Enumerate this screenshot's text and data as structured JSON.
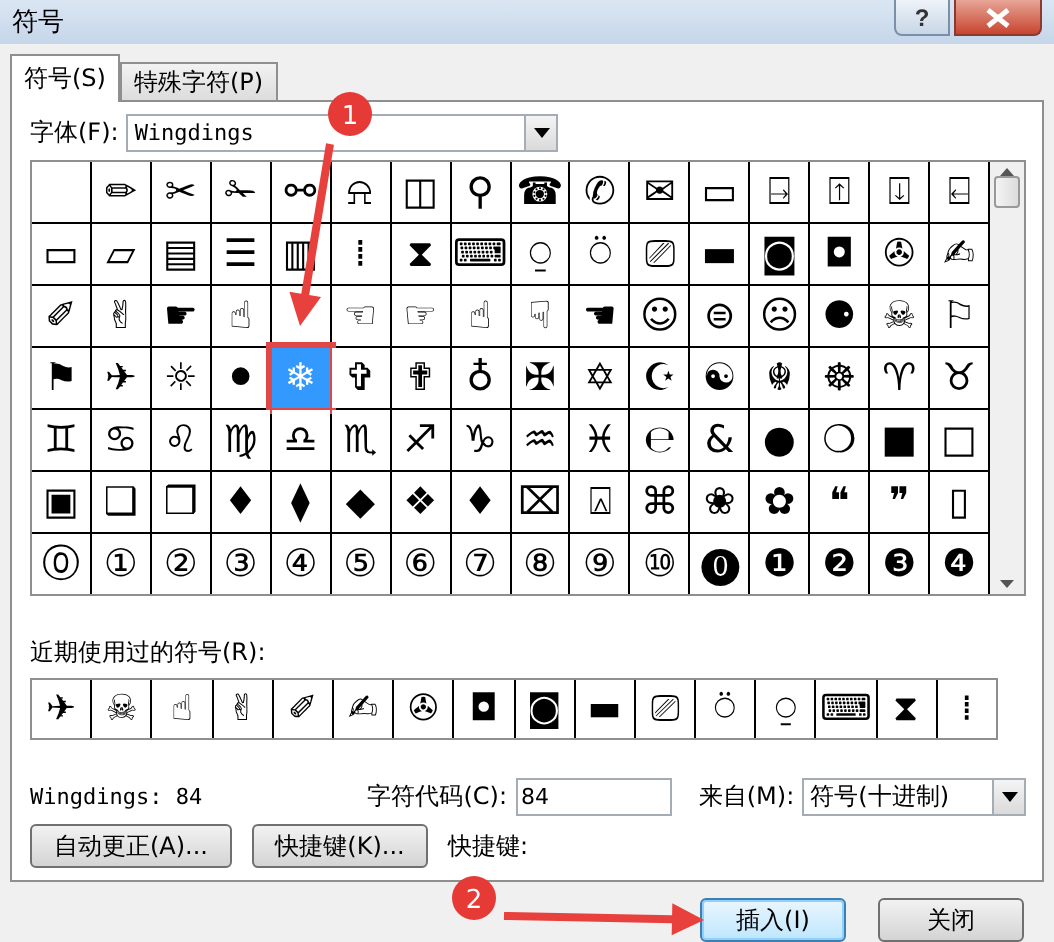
{
  "window": {
    "title": "符号",
    "help": "?"
  },
  "tabs": [
    {
      "label": "符号(S)",
      "selected": true
    },
    {
      "label": "特殊字符(P)",
      "selected": false
    }
  ],
  "font": {
    "label": "字体(F):",
    "value": "Wingdings"
  },
  "symbol_rows": [
    [
      {
        "selected": false
      },
      {
        "glyph": "✏",
        "selected": false
      },
      {
        "glyph": "✂",
        "selected": false
      },
      {
        "glyph": "✁",
        "selected": false
      },
      {
        "glyph": "⚯",
        "selected": false
      },
      {
        "glyph": "⍾",
        "selected": false
      },
      {
        "glyph": "◫",
        "selected": false
      },
      {
        "glyph": "⚲",
        "selected": false
      },
      {
        "glyph": "☎",
        "selected": false
      },
      {
        "glyph": "✆",
        "selected": false
      },
      {
        "glyph": "✉",
        "selected": false
      },
      {
        "glyph": "▭",
        "selected": false
      },
      {
        "glyph": "⍈",
        "selected": false
      },
      {
        "glyph": "⍐",
        "selected": false
      },
      {
        "glyph": "⍗",
        "selected": false
      },
      {
        "glyph": "⍇",
        "selected": false
      }
    ],
    [
      {
        "glyph": "▭",
        "selected": false
      },
      {
        "glyph": "▱",
        "selected": false
      },
      {
        "glyph": "▤",
        "selected": false
      },
      {
        "glyph": "☰",
        "selected": false
      },
      {
        "glyph": "▥",
        "selected": false
      },
      {
        "glyph": "⁞",
        "selected": false
      },
      {
        "glyph": "⧗",
        "selected": false
      },
      {
        "glyph": "⌨",
        "selected": false
      },
      {
        "glyph": "⍜",
        "selected": false
      },
      {
        "glyph": "⍥",
        "selected": false
      },
      {
        "glyph": "⎚",
        "selected": false
      },
      {
        "glyph": "▬",
        "selected": false
      },
      {
        "glyph": "◙",
        "selected": false
      },
      {
        "glyph": "◘",
        "selected": false
      },
      {
        "glyph": "✇",
        "selected": false
      },
      {
        "glyph": "✍",
        "selected": false
      }
    ],
    [
      {
        "glyph": "✐",
        "selected": false
      },
      {
        "glyph": "✌",
        "selected": false
      },
      {
        "glyph": "☛",
        "selected": false
      },
      {
        "glyph": "☝",
        "selected": false
      },
      {
        "selected": false
      },
      {
        "glyph": "☜",
        "selected": false
      },
      {
        "glyph": "☞",
        "selected": false
      },
      {
        "glyph": "☝",
        "selected": false
      },
      {
        "glyph": "☟",
        "selected": false
      },
      {
        "glyph": "☚",
        "selected": false
      },
      {
        "glyph": "☺",
        "selected": false
      },
      {
        "glyph": "⊜",
        "selected": false
      },
      {
        "glyph": "☹",
        "selected": false
      },
      {
        "glyph": "⚈",
        "selected": false
      },
      {
        "glyph": "☠",
        "selected": false
      },
      {
        "glyph": "⚐",
        "selected": false
      }
    ],
    [
      {
        "glyph": "⚑",
        "selected": false
      },
      {
        "glyph": "✈",
        "selected": false
      },
      {
        "glyph": "☼",
        "selected": false
      },
      {
        "glyph": "⚫",
        "selected": false
      },
      {
        "glyph": "❄",
        "selected": true
      },
      {
        "glyph": "✞",
        "selected": false
      },
      {
        "glyph": "✟",
        "selected": false
      },
      {
        "glyph": "♁",
        "selected": false
      },
      {
        "glyph": "✠",
        "selected": false
      },
      {
        "glyph": "✡",
        "selected": false
      },
      {
        "glyph": "☪",
        "selected": false
      },
      {
        "glyph": "☯",
        "selected": false
      },
      {
        "glyph": "☬",
        "selected": false
      },
      {
        "glyph": "☸",
        "selected": false
      },
      {
        "glyph": "♈",
        "selected": false
      },
      {
        "glyph": "♉",
        "selected": false
      }
    ],
    [
      {
        "glyph": "♊",
        "selected": false
      },
      {
        "glyph": "♋",
        "selected": false
      },
      {
        "glyph": "♌",
        "selected": false
      },
      {
        "glyph": "♍",
        "selected": false
      },
      {
        "glyph": "♎",
        "selected": false
      },
      {
        "glyph": "♏",
        "selected": false
      },
      {
        "glyph": "♐",
        "selected": false
      },
      {
        "glyph": "♑",
        "selected": false
      },
      {
        "glyph": "♒",
        "selected": false
      },
      {
        "glyph": "♓",
        "selected": false
      },
      {
        "glyph": "℮",
        "selected": false
      },
      {
        "glyph": "&",
        "selected": false
      },
      {
        "glyph": "●",
        "selected": false
      },
      {
        "glyph": "❍",
        "selected": false
      },
      {
        "glyph": "■",
        "selected": false
      },
      {
        "glyph": "□",
        "selected": false
      }
    ],
    [
      {
        "glyph": "▣",
        "selected": false
      },
      {
        "glyph": "❑",
        "selected": false
      },
      {
        "glyph": "❒",
        "selected": false
      },
      {
        "glyph": "♦",
        "selected": false
      },
      {
        "glyph": "⧫",
        "selected": false
      },
      {
        "glyph": "◆",
        "selected": false
      },
      {
        "glyph": "❖",
        "selected": false
      },
      {
        "glyph": "♦",
        "selected": false
      },
      {
        "glyph": "⌧",
        "selected": false
      },
      {
        "glyph": "⍓",
        "selected": false
      },
      {
        "glyph": "⌘",
        "selected": false
      },
      {
        "glyph": "❀",
        "selected": false
      },
      {
        "glyph": "✿",
        "selected": false
      },
      {
        "glyph": "❝",
        "selected": false
      },
      {
        "glyph": "❞",
        "selected": false
      },
      {
        "glyph": "▯",
        "selected": false
      }
    ],
    [
      {
        "glyph": "⓪",
        "selected": false
      },
      {
        "glyph": "①",
        "selected": false
      },
      {
        "glyph": "②",
        "selected": false
      },
      {
        "glyph": "③",
        "selected": false
      },
      {
        "glyph": "④",
        "selected": false
      },
      {
        "glyph": "⑤",
        "selected": false
      },
      {
        "glyph": "⑥",
        "selected": false
      },
      {
        "glyph": "⑦",
        "selected": false
      },
      {
        "glyph": "⑧",
        "selected": false
      },
      {
        "glyph": "⑨",
        "selected": false
      },
      {
        "glyph": "⑩",
        "selected": false
      },
      {
        "glyph": "⓿",
        "selected": false
      },
      {
        "glyph": "❶",
        "selected": false
      },
      {
        "glyph": "❷",
        "selected": false
      },
      {
        "glyph": "❸",
        "selected": false
      },
      {
        "glyph": "❹",
        "selected": false
      }
    ]
  ],
  "recent": {
    "label": "近期使用过的符号(R):",
    "symbols": [
      "✈",
      "☠",
      "☝",
      "✌",
      "✐",
      "✍",
      "✇",
      "◘",
      "◙",
      "▬",
      "⎚",
      "⍥",
      "⍜",
      "⌨",
      "⧗",
      "⁞"
    ]
  },
  "font_info": "Wingdings: 84",
  "char_code": {
    "label": "字符代码(C):",
    "value": "84"
  },
  "from": {
    "label": "来自(M):",
    "value": "符号(十进制)"
  },
  "panel_buttons": [
    "自动更正(A)...",
    "快捷键(K)..."
  ],
  "shortcut_label": "快捷键:",
  "footer_buttons": [
    {
      "label": "插入(I)",
      "focused": true
    },
    {
      "label": "关闭",
      "focused": false
    }
  ],
  "annotations": [
    {
      "number": "1"
    },
    {
      "number": "2"
    }
  ]
}
